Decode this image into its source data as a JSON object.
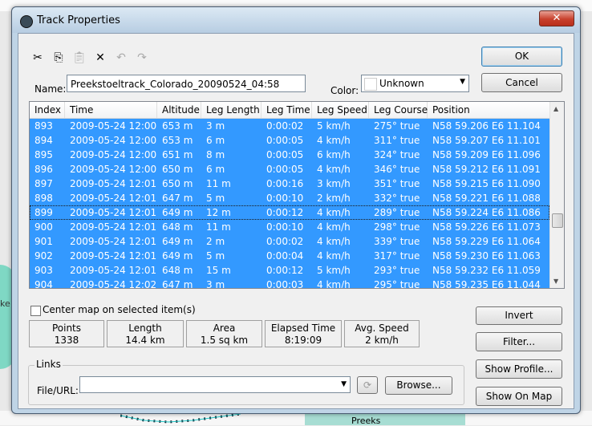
{
  "window": {
    "title": "Track Properties",
    "close_label": "✕"
  },
  "toolbar": {
    "icons": [
      "scissors-icon",
      "copy-icon",
      "paste-icon",
      "delete-icon",
      "undo-icon",
      "redo-icon"
    ]
  },
  "name": {
    "label": "Name:",
    "value": "Preekstoeltrack_Colorado_20090524_04:58"
  },
  "color": {
    "label": "Color:",
    "value": "Unknown",
    "swatch": "#ffffff"
  },
  "buttons": {
    "ok": "OK",
    "cancel": "Cancel",
    "invert": "Invert",
    "filter": "Filter...",
    "show_profile": "Show Profile...",
    "show_on_map": "Show On Map",
    "browse": "Browse..."
  },
  "table": {
    "columns": [
      "Index",
      "Time",
      "Altitude",
      "Leg Length",
      "Leg Time",
      "Leg Speed",
      "Leg Course",
      "Position"
    ],
    "rows": [
      [
        "893",
        "2009-05-24 12:00",
        "653 m",
        "3 m",
        "0:00:02",
        "5 km/h",
        "275° true",
        "N58 59.206 E6 11.104"
      ],
      [
        "894",
        "2009-05-24 12:00",
        "653 m",
        "6 m",
        "0:00:05",
        "4 km/h",
        "311° true",
        "N58 59.207 E6 11.101"
      ],
      [
        "895",
        "2009-05-24 12:00",
        "651 m",
        "8 m",
        "0:00:05",
        "6 km/h",
        "324° true",
        "N58 59.209 E6 11.096"
      ],
      [
        "896",
        "2009-05-24 12:00",
        "650 m",
        "6 m",
        "0:00:05",
        "4 km/h",
        "346° true",
        "N58 59.212 E6 11.091"
      ],
      [
        "897",
        "2009-05-24 12:01",
        "650 m",
        "11 m",
        "0:00:16",
        "3 km/h",
        "351° true",
        "N58 59.215 E6 11.090"
      ],
      [
        "898",
        "2009-05-24 12:01",
        "647 m",
        "5 m",
        "0:00:10",
        "2 km/h",
        "332° true",
        "N58 59.221 E6 11.088"
      ],
      [
        "899",
        "2009-05-24 12:01",
        "649 m",
        "12 m",
        "0:00:12",
        "4 km/h",
        "289° true",
        "N58 59.224 E6 11.086"
      ],
      [
        "900",
        "2009-05-24 12:01",
        "648 m",
        "11 m",
        "0:00:10",
        "4 km/h",
        "298° true",
        "N58 59.226 E6 11.073"
      ],
      [
        "901",
        "2009-05-24 12:01",
        "649 m",
        "2 m",
        "0:00:02",
        "4 km/h",
        "339° true",
        "N58 59.229 E6 11.064"
      ],
      [
        "902",
        "2009-05-24 12:01",
        "649 m",
        "5 m",
        "0:00:04",
        "4 km/h",
        "317° true",
        "N58 59.230 E6 11.063"
      ],
      [
        "903",
        "2009-05-24 12:01",
        "648 m",
        "15 m",
        "0:00:12",
        "5 km/h",
        "293° true",
        "N58 59.232 E6 11.059"
      ],
      [
        "904",
        "2009-05-24 12:02",
        "647 m",
        "3 m",
        "0:00:03",
        "4 km/h",
        "295° true",
        "N58 59.235 E6 11.044"
      ]
    ]
  },
  "center_map": {
    "label": "Center map on selected item(s)",
    "checked": false
  },
  "stats": [
    {
      "label": "Points",
      "value": "1338"
    },
    {
      "label": "Length",
      "value": "14.4 km"
    },
    {
      "label": "Area",
      "value": "1.5 sq km"
    },
    {
      "label": "Elapsed Time",
      "value": "8:19:09"
    },
    {
      "label": "Avg. Speed",
      "value": "2 km/h"
    }
  ],
  "links": {
    "title": "Links",
    "file_label": "File/URL:",
    "file_value": ""
  },
  "colors": {
    "selection": "#3399ff",
    "title_bg": "#bfd4e6"
  }
}
